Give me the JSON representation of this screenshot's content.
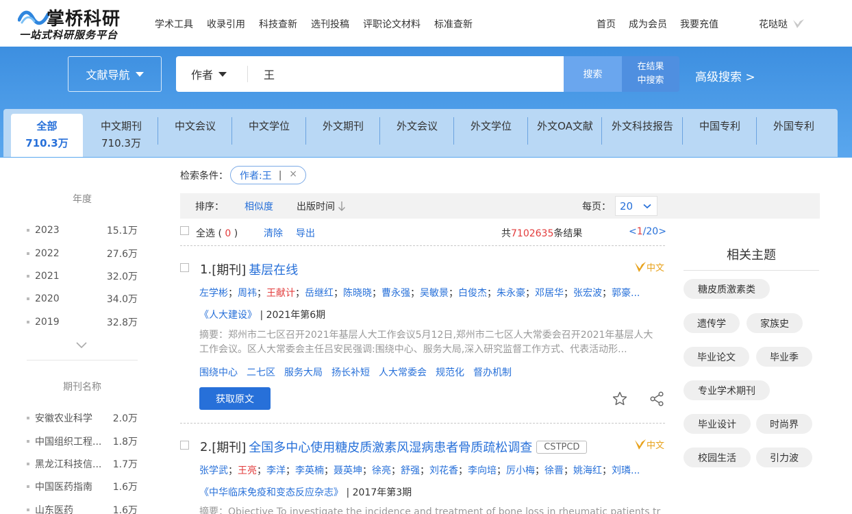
{
  "brand": {
    "name": "掌桥科研",
    "slogan": "一站式科研服务平台"
  },
  "topnav": [
    "学术工具",
    "收录引用",
    "科技查新",
    "选刊投稿",
    "评职论文材料",
    "标准查新"
  ],
  "rightnav": [
    "首页",
    "成为会员",
    "我要充值"
  ],
  "user": {
    "name": "花哒哒"
  },
  "search": {
    "nav_label": "文献导航",
    "field": "作者",
    "query": "王",
    "search_label": "搜索",
    "within_line1": "在结果",
    "within_line2": "中搜索",
    "advanced": "高级搜索 >"
  },
  "tabs": [
    {
      "label": "全部",
      "count": "710.3万"
    },
    {
      "label": "中文期刊",
      "count": "710.3万"
    },
    {
      "label": "中文会议",
      "count": ""
    },
    {
      "label": "中文学位",
      "count": ""
    },
    {
      "label": "外文期刊",
      "count": ""
    },
    {
      "label": "外文会议",
      "count": ""
    },
    {
      "label": "外文学位",
      "count": ""
    },
    {
      "label": "外文OA文献",
      "count": ""
    },
    {
      "label": "外文科技报告",
      "count": ""
    },
    {
      "label": "中国专利",
      "count": ""
    },
    {
      "label": "外国专利",
      "count": ""
    }
  ],
  "sidebar": {
    "year_title": "年度",
    "years": [
      {
        "name": "2023",
        "count": "15.1万"
      },
      {
        "name": "2022",
        "count": "27.6万"
      },
      {
        "name": "2021",
        "count": "32.0万"
      },
      {
        "name": "2020",
        "count": "34.0万"
      },
      {
        "name": "2019",
        "count": "32.8万"
      }
    ],
    "journal_title": "期刊名称",
    "journals": [
      {
        "name": "安徽农业科学",
        "count": "2.0万"
      },
      {
        "name": "中国组织工程...",
        "count": "1.8万"
      },
      {
        "name": "黑龙江科技信...",
        "count": "1.7万"
      },
      {
        "name": "中国医药指南",
        "count": "1.6万"
      },
      {
        "name": "山东医药",
        "count": "1.6万"
      }
    ]
  },
  "conditions": {
    "label": "检索条件：",
    "chip": "作者:王",
    "chip_bar": "|",
    "chip_close": "×"
  },
  "sort": {
    "label": "排序：",
    "relevance": "相似度",
    "date": "出版时间",
    "per_page_label": "每页：",
    "per_page": "20"
  },
  "tools": {
    "select_all": "全选",
    "paren_open": "(",
    "selected_count": "0",
    "paren_close": ")",
    "clear": "清除",
    "export": "导出",
    "total_prefix": "共",
    "total": "7102635",
    "total_suffix": "条结果",
    "page_prev": "<",
    "page_current": "1",
    "page_rest": "/20>"
  },
  "results": [
    {
      "index": "1.",
      "type": "[期刊]",
      "title": "基层在线",
      "tag": "",
      "lang": "中文",
      "authors": [
        "左学彬",
        "周祎",
        "王献计",
        "岳继红",
        "陈晓晓",
        "曹永强",
        "吴敏景",
        "白俊杰",
        "朱永豪",
        "邓居华",
        "张宏波",
        "郭豪..."
      ],
      "highlight_author": "王献计",
      "journal": "《人大建设》",
      "issue": "| 2021年第6期",
      "abstract": "摘要：郑州市二七区召开2021年基层人大工作会议5月12日,郑州市二七区人大常委会召开2021年基层人大工作会议。区人大常委会主任吕安民强调:围绕中心、服务大局,深入研究监督工作方式、代表活动形...",
      "keywords": [
        "围绕中心",
        "二七区",
        "服务大局",
        "扬长补短",
        "人大常委会",
        "规范化",
        "督办机制"
      ],
      "action": "获取原文"
    },
    {
      "index": "2.",
      "type": "[期刊]",
      "title": "全国多中心使用糖皮质激素风湿病患者骨质疏松调查",
      "tag": "CSTPCD",
      "lang": "中文",
      "authors": [
        "张学武",
        "王亮",
        "李洋",
        "李英楠",
        "聂英坤",
        "徐亮",
        "舒强",
        "刘花香",
        "李向培",
        "厉小梅",
        "徐晋",
        "姚海红",
        "刘璘..."
      ],
      "highlight_author": "王亮",
      "journal": "《中华临床免疫和变态反应杂志》",
      "issue": "| 2017年第3期",
      "abstract": "摘要：Objective To investigate the incidence and treatment of bone loss in rheumatic patients tr"
    }
  ],
  "related": {
    "title": "相关主题",
    "topics": [
      "糖皮质激素类",
      "遗传学",
      "家族史",
      "毕业论文",
      "毕业季",
      "专业学术期刊",
      "毕业设计",
      "时尚界",
      "校园生活",
      "引力波"
    ]
  },
  "colors": {
    "accent": "#2770d9",
    "band": "#4a9be8",
    "highlight": "#e23b3b"
  }
}
